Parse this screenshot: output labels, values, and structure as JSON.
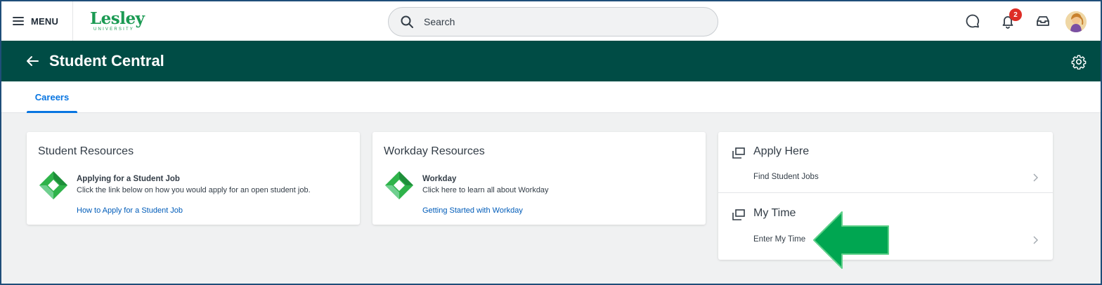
{
  "topbar": {
    "menu_label": "MENU",
    "logo": {
      "name": "Lesley",
      "sub": "UNIVERSITY",
      "color": "#1b9a53"
    },
    "search_placeholder": "Search",
    "notification_count": "2",
    "icons": [
      "chat-icon",
      "notification-bell-icon",
      "inbox-icon",
      "avatar"
    ]
  },
  "header": {
    "title": "Student Central",
    "background": "#004c45"
  },
  "tabs": [
    {
      "label": "Careers",
      "active": true
    }
  ],
  "cards": {
    "student_resources": {
      "title": "Student Resources",
      "item_title": "Applying for a Student Job",
      "item_desc": "Click the link below on how you would apply for an open student job.",
      "link": "How to Apply for a Student Job"
    },
    "workday_resources": {
      "title": "Workday Resources",
      "item_title": "Workday",
      "item_desc": "Click here to learn all about Workday",
      "link": "Getting Started with Workday"
    },
    "apply_here": {
      "title": "Apply Here",
      "item": "Find Student Jobs"
    },
    "my_time": {
      "title": "My Time",
      "item": "Enter My Time"
    }
  },
  "annotation": {
    "type": "arrow",
    "color": "#00a651",
    "direction": "left"
  },
  "colors": {
    "accent": "#0875e1",
    "link": "#005cb9",
    "badge": "#de2d26"
  }
}
